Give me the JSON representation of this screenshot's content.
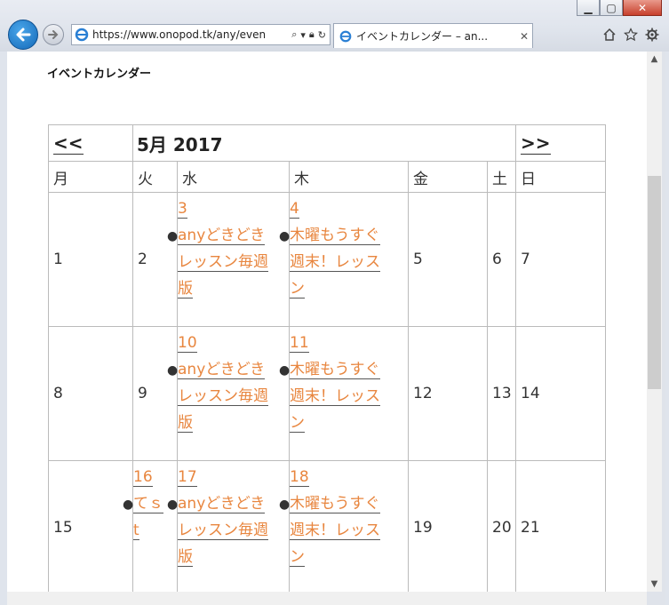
{
  "browser": {
    "url": "https://www.onopod.tk/any/even",
    "tab_title": "イベントカレンダー – an...",
    "colors": {
      "accent": "#1469b8",
      "link": "#e8863f"
    }
  },
  "page": {
    "title": "イベントカレンダー",
    "calendar": {
      "prev_label": "<<",
      "next_label": ">>",
      "month_label": "5月 2017",
      "weekdays": [
        "月",
        "火",
        "水",
        "木",
        "金",
        "土",
        "日"
      ],
      "weeks": [
        {
          "days": [
            "1",
            "2",
            "3",
            "4",
            "5",
            "6",
            "7"
          ],
          "wed_event": {
            "day": "3",
            "title_lines": [
              "anyどきどき",
              "レッスン毎週",
              "版"
            ]
          },
          "thu_event": {
            "day": "4",
            "title_lines": [
              "木曜もうすぐ",
              "週末！レッス",
              "ン"
            ]
          }
        },
        {
          "days": [
            "8",
            "9",
            "10",
            "11",
            "12",
            "13",
            "14"
          ],
          "wed_event": {
            "day": "10",
            "title_lines": [
              "anyどきどき",
              "レッスン毎週",
              "版"
            ]
          },
          "thu_event": {
            "day": "11",
            "title_lines": [
              "木曜もうすぐ",
              "週末！レッス",
              "ン"
            ]
          }
        },
        {
          "days": [
            "15",
            "16",
            "17",
            "18",
            "19",
            "20",
            "21"
          ],
          "tue_event": {
            "day": "16",
            "title_lines": [
              "てｓ",
              "t"
            ]
          },
          "wed_event": {
            "day": "17",
            "title_lines": [
              "anyどきどき",
              "レッスン毎週",
              "版"
            ]
          },
          "thu_event": {
            "day": "18",
            "title_lines": [
              "木曜もうすぐ",
              "週末！レッス",
              "ン"
            ]
          }
        }
      ]
    }
  }
}
